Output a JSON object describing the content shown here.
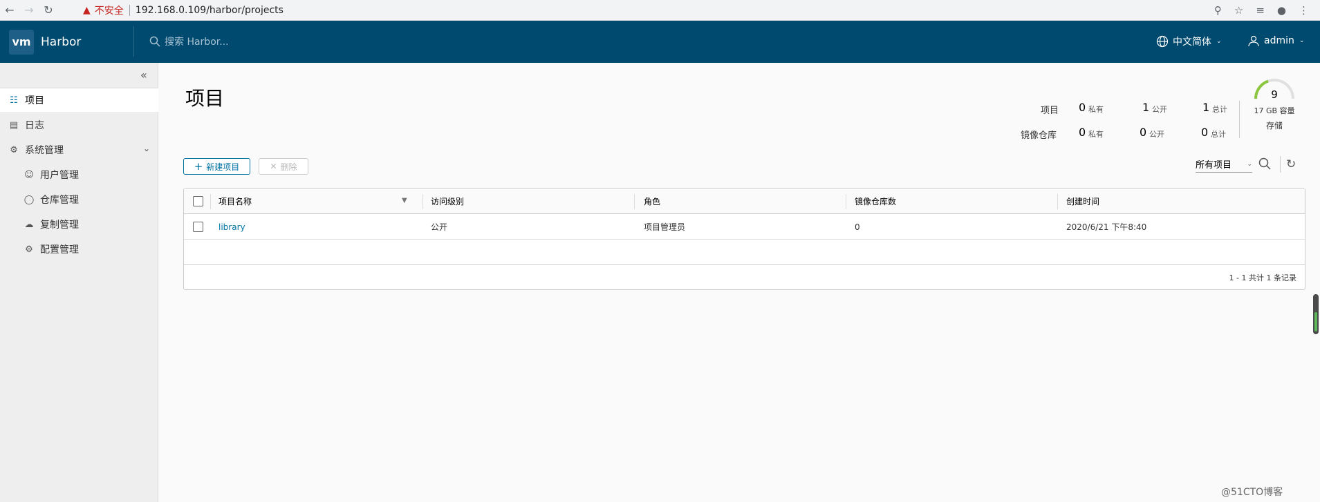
{
  "browser": {
    "warning": "不安全",
    "url": "192.168.0.109/harbor/projects"
  },
  "header": {
    "logo": "vm",
    "app_name": "Harbor",
    "search_placeholder": "搜索 Harbor...",
    "language": "中文简体",
    "user": "admin"
  },
  "sidebar": {
    "items": [
      {
        "label": "项目",
        "icon": "projects-icon"
      },
      {
        "label": "日志",
        "icon": "logs-icon"
      },
      {
        "label": "系统管理",
        "icon": "admin-icon"
      }
    ],
    "sub_items": [
      {
        "label": "用户管理",
        "icon": "users-icon"
      },
      {
        "label": "仓库管理",
        "icon": "registry-icon"
      },
      {
        "label": "复制管理",
        "icon": "replication-icon"
      },
      {
        "label": "配置管理",
        "icon": "config-icon"
      }
    ]
  },
  "page": {
    "title": "项目"
  },
  "stats": {
    "row_labels": [
      "项目",
      "镜像仓库"
    ],
    "projects": {
      "private": "0",
      "public": "1",
      "total": "1"
    },
    "repos": {
      "private": "0",
      "public": "0",
      "total": "0"
    },
    "units": {
      "private": "私有",
      "public": "公开",
      "total": "总计"
    },
    "storage": {
      "value": "9",
      "capacity": "17 GB 容量",
      "label": "存储"
    }
  },
  "toolbar": {
    "new_label": "新建项目",
    "delete_label": "删除",
    "filter_label": "所有项目"
  },
  "table": {
    "columns": [
      "项目名称",
      "访问级别",
      "角色",
      "镜像仓库数",
      "创建时间"
    ],
    "rows": [
      {
        "name": "library",
        "access": "公开",
        "role": "项目管理员",
        "repos": "0",
        "created": "2020/6/21 下午8:40"
      }
    ],
    "footer": "1 - 1 共计 1 条记录"
  },
  "watermark": "@51CTO博客",
  "colors": {
    "header_bg": "#004a70",
    "accent": "#0072a3",
    "gauge": "#8cc63f"
  }
}
